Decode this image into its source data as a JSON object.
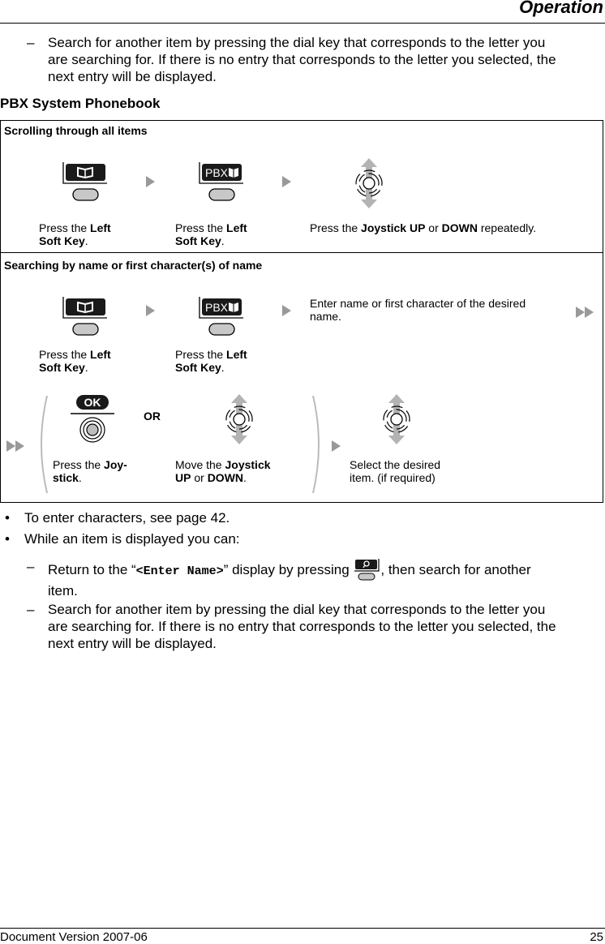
{
  "header": {
    "title": "Operation"
  },
  "intro_item": {
    "bullet": "–",
    "lines": [
      "Search for another item by pressing the dial key that corresponds to the letter you",
      "are searching for. If there is no entry that corresponds to the letter you selected, the",
      "next entry will be displayed."
    ]
  },
  "section": {
    "title": "PBX System Phonebook"
  },
  "table": {
    "rows": [
      {
        "title": "Scrolling through all items",
        "steps": [
          {
            "icon": "phonebook-soft-key-icon",
            "caption_pre": "Press the ",
            "caption_bold1": "Left",
            "caption_line2_bold": "Soft Key",
            "caption_end": "."
          },
          {
            "icon": "pbx-phonebook-soft-key-icon",
            "label": "PBX",
            "caption_pre": "Press the ",
            "caption_bold1": "Left",
            "caption_line2_bold": "Soft Key",
            "caption_end": "."
          },
          {
            "icon": "joystick-up-down-icon",
            "caption_pre": "Press the ",
            "caption_bold1": "Joystick UP",
            "caption_mid": " or ",
            "caption_bold2": "DOWN",
            "caption_end": " repeatedly."
          }
        ]
      },
      {
        "title": "Searching by name or first character(s) of name",
        "steps": [
          {
            "icon": "phonebook-soft-key-icon",
            "caption_pre": "Press the ",
            "caption_bold1": "Left",
            "caption_line2_bold": "Soft Key",
            "caption_end": "."
          },
          {
            "icon": "pbx-phonebook-soft-key-icon",
            "label": "PBX",
            "caption_pre": "Press the ",
            "caption_bold1": "Left",
            "caption_line2_bold": "Soft Key",
            "caption_end": "."
          },
          {
            "caption_line1": "Enter name or first character of the desired",
            "caption_line2": "name."
          }
        ],
        "substeps": [
          {
            "icon": "ok-joystick-press-icon",
            "ok_label": "OK",
            "caption_pre": "Press the ",
            "caption_bold1": "Joy-",
            "caption_line2_bold": "stick",
            "caption_end": "."
          },
          {
            "or_label": "OR"
          },
          {
            "icon": "joystick-up-down-icon",
            "caption_pre": "Move the ",
            "caption_bold1": "Joystick",
            "caption_line2_bold": "UP",
            "caption_mid": " or ",
            "caption_bold2": "DOWN",
            "caption_end": "."
          },
          {
            "icon": "joystick-up-down-icon",
            "caption_line1": "Select the desired",
            "caption_line2": "item. (if required)"
          }
        ]
      }
    ]
  },
  "notes": {
    "bullets": [
      {
        "bullet": "•",
        "text": "To enter characters, see page 42."
      },
      {
        "bullet": "•",
        "text": "While an item is displayed you can:"
      }
    ],
    "subitems": [
      {
        "bullet": "–",
        "pre": "Return to the “",
        "code": "<Enter Name>",
        "post": "” display by pressing ",
        "icon": "search-soft-key-icon",
        "after": ", then search for another",
        "line2": "item."
      },
      {
        "bullet": "–",
        "lines": [
          "Search for another item by pressing the dial key that corresponds to the letter you",
          "are searching for. If there is no entry that corresponds to the letter you selected, the",
          "next entry will be displayed."
        ]
      }
    ]
  },
  "footer": {
    "left": "Document Version 2007-06",
    "page": "25"
  }
}
